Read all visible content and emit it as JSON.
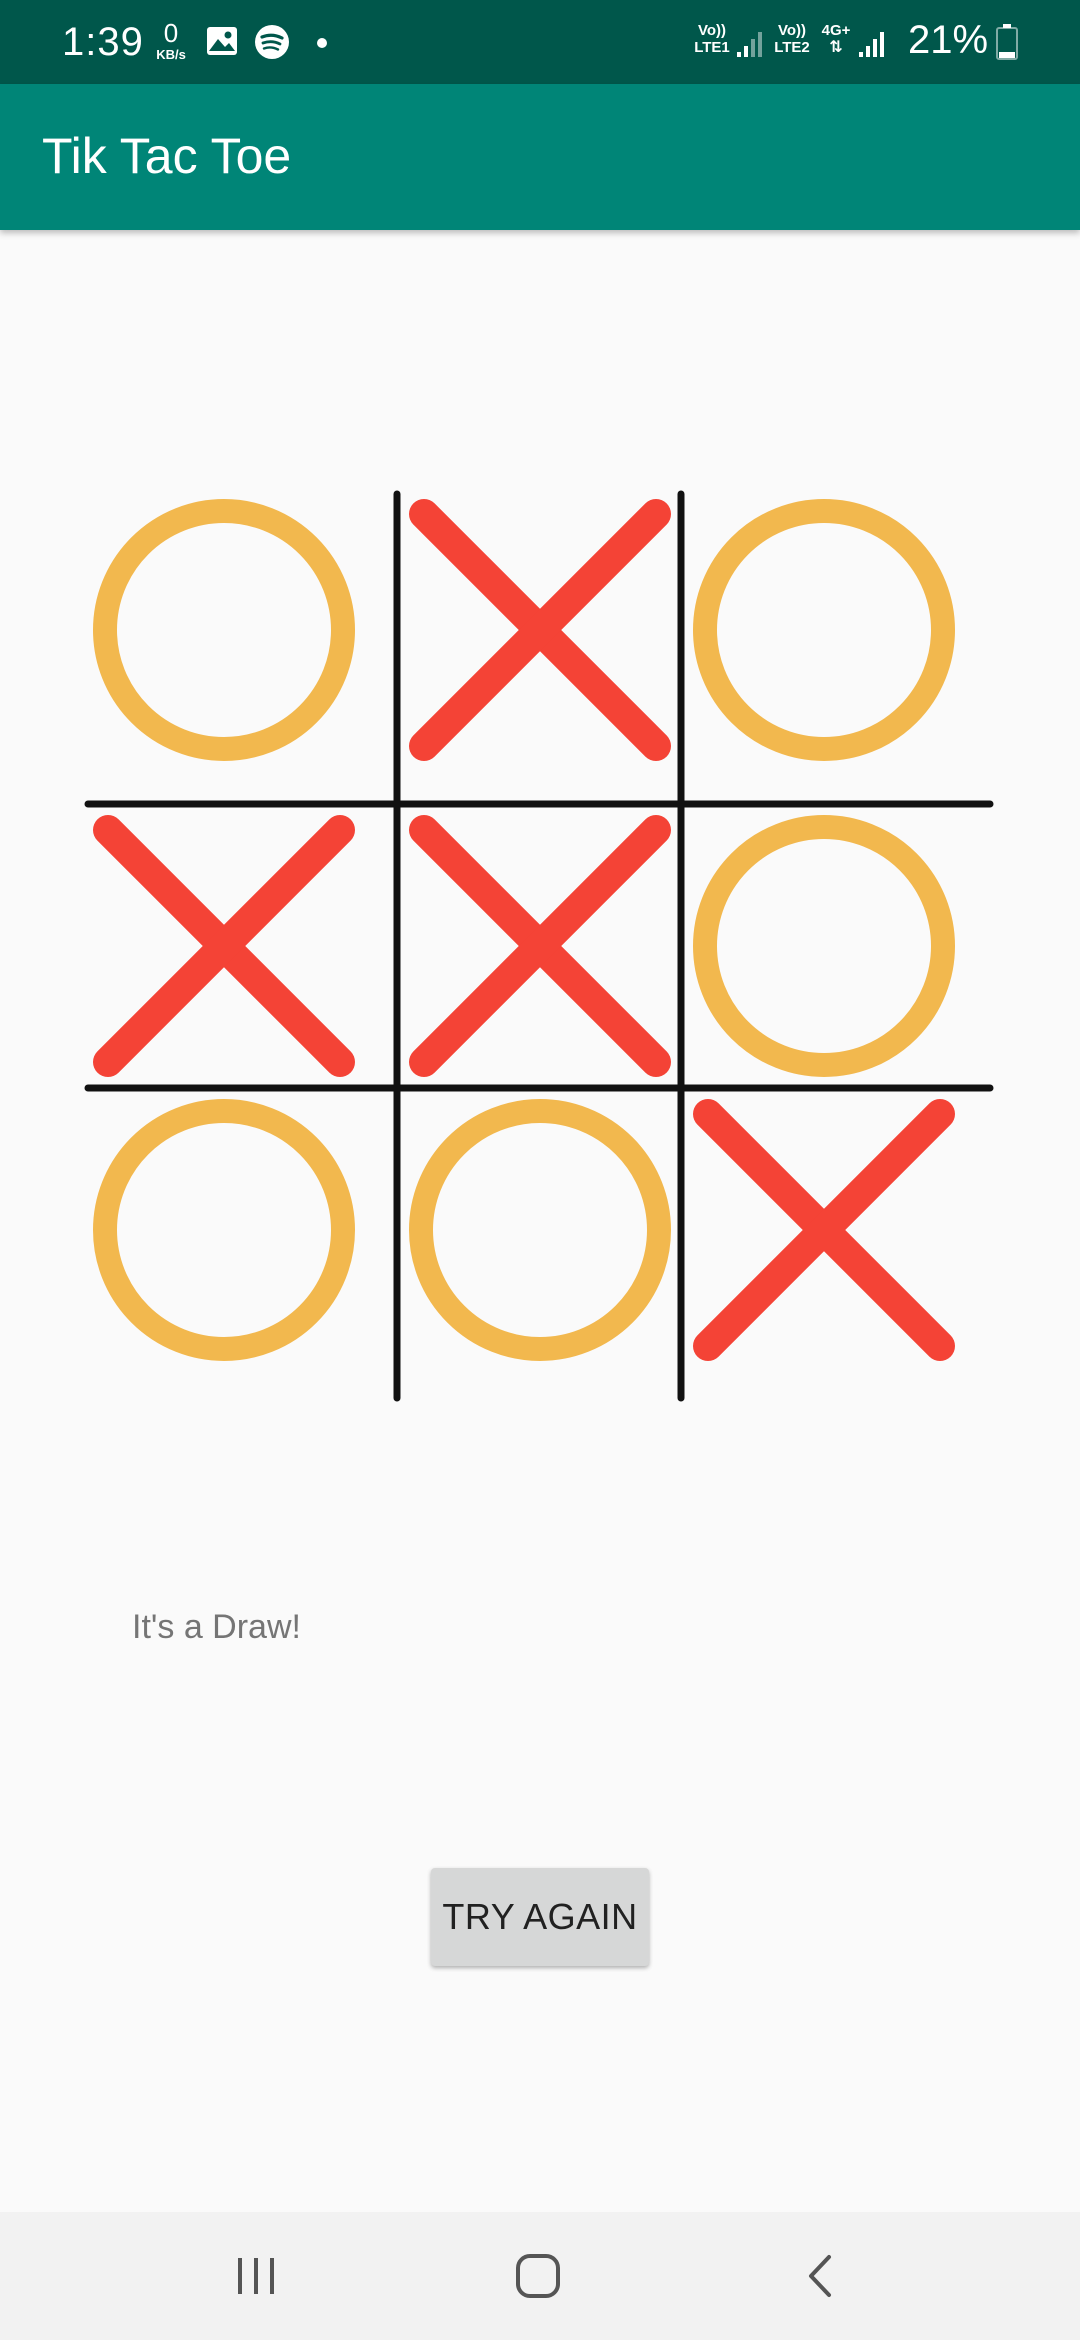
{
  "status_bar": {
    "time": "1:39",
    "net_speed_value": "0",
    "net_speed_unit": "KB/s",
    "icons": [
      "gallery-icon",
      "spotify-icon",
      "notification-dot-icon"
    ],
    "sim1_top": "Vo))",
    "sim1_bottom": "LTE1",
    "sim2_top": "Vo))",
    "sim2_bottom": "LTE2",
    "network_type": "4G+",
    "battery_percent": "21%",
    "battery_level": 0.21
  },
  "app_bar": {
    "title": "Tik Tac Toe"
  },
  "board": {
    "cells": [
      "O",
      "X",
      "O",
      "X",
      "X",
      "O",
      "O",
      "O",
      "X"
    ],
    "colors": {
      "x": "#f44336",
      "o": "#f2b84e",
      "grid": "#111111"
    }
  },
  "result": {
    "message": "It's a Draw!"
  },
  "actions": {
    "try_again_label": "TRY AGAIN"
  },
  "nav_bar": {
    "buttons": [
      "recent-apps-icon",
      "home-icon",
      "back-icon"
    ]
  },
  "theme": {
    "status_bar_color": "#00574b",
    "app_bar_color": "#008577",
    "background": "#fafafa"
  }
}
